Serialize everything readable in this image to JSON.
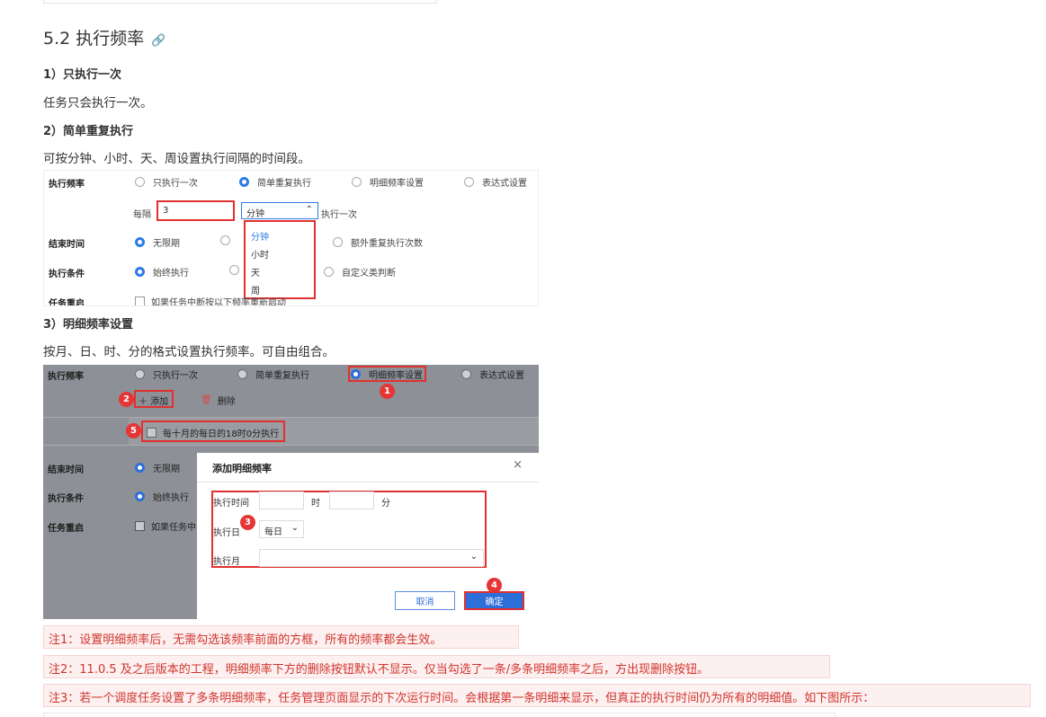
{
  "section": {
    "title": "5.2 执行频率",
    "anchor_icon": "link-icon",
    "anchor_glyph": "🔗",
    "h_once": "1）只执行一次",
    "p_once": "任务只会执行一次。",
    "h_simple": "2）简单重复执行",
    "p_simple": "可按分钟、小时、天、周设置执行间隔的时间段。",
    "h_detail": "3）明细频率设置",
    "p_detail": "按月、日、时、分的格式设置执行频率。可自由组合。"
  },
  "shot1": {
    "label_freq": "执行频率",
    "opt_once": "只执行一次",
    "opt_simple": "简单重复执行",
    "opt_detail": "明细频率设置",
    "opt_expr": "表达式设置",
    "every_label": "每隔",
    "every_value": "3",
    "unit_selected": "分钟",
    "exec_once_suffix": "执行一次",
    "label_end": "结束时间",
    "end_unlimited": "无限期",
    "end_extra": "额外重复执行次数",
    "label_cond": "执行条件",
    "cond_always": "始终执行",
    "cond_custom": "自定义类判断",
    "label_restart": "任务重启",
    "restart_text": "如果任务中断按以下频率重新启动",
    "unit_options": [
      "分钟",
      "小时",
      "天",
      "周"
    ]
  },
  "shot2": {
    "label_freq": "执行频率",
    "opt_once": "只执行一次",
    "opt_simple": "简单重复执行",
    "opt_detail": "明细频率设置",
    "opt_expr": "表达式设置",
    "add_label": "添加",
    "delete_label": "删除",
    "freq_item": "每十月的每日的18时0分执行",
    "label_end": "结束时间",
    "end_unlimited": "无限期",
    "label_cond": "执行条件",
    "cond_always": "始终执行",
    "label_restart": "任务重启",
    "restart_text": "如果任务中",
    "badges": [
      "1",
      "2",
      "3",
      "4",
      "5"
    ],
    "dialog": {
      "title": "添加明细频率",
      "close": "×",
      "exec_time": "执行时间",
      "hour_unit": "时",
      "minute_unit": "分",
      "exec_day": "执行日",
      "day_value": "每日",
      "exec_month": "执行月",
      "cancel": "取消",
      "ok": "确定"
    }
  },
  "notes": {
    "n1": "注1：设置明细频率后，无需勾选该频率前面的方框，所有的频率都会生效。",
    "n2": "注2：11.0.5 及之后版本的工程，明细频率下方的删除按钮默认不显示。仅当勾选了一条/多条明细频率之后，方出现删除按钮。",
    "n3": "注3：若一个调度任务设置了多条明细频率，任务管理页面显示的下次运行时间。会根据第一条明细来显示，但真正的执行时间仍为所有的明细值。如下图所示："
  },
  "colors": {
    "accent": "#2d7be5",
    "highlight": "#e03030",
    "note_text": "#d0342c",
    "note_bg": "#fdf0f0"
  }
}
